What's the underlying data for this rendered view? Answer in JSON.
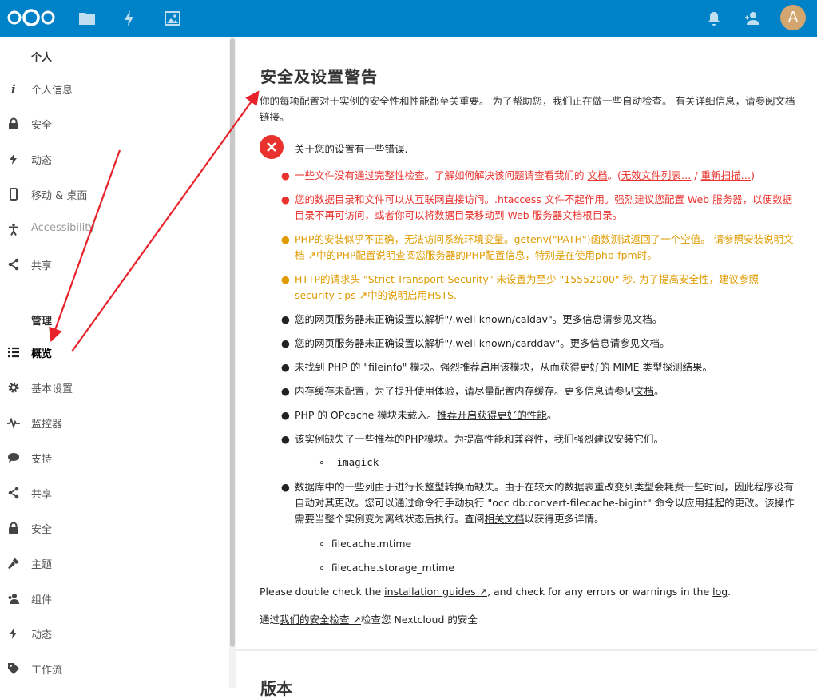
{
  "header": {
    "avatar_letter": "A",
    "icons": [
      "nextcloud-logo",
      "files-icon",
      "activity-icon",
      "gallery-icon",
      "notifications-icon",
      "contacts-icon"
    ],
    "bg_color": "#0082c9"
  },
  "sidebar": {
    "personal_title": "个人",
    "personal_items": [
      {
        "label": "个人信息",
        "icon": "info-icon"
      },
      {
        "label": "安全",
        "icon": "lock-icon"
      },
      {
        "label": "动态",
        "icon": "activity-icon"
      },
      {
        "label": "移动 & 桌面",
        "icon": "mobile-icon"
      },
      {
        "label": "Accessibility",
        "icon": "accessibility-icon"
      },
      {
        "label": "共享",
        "icon": "share-icon"
      }
    ],
    "admin_title": "管理",
    "admin_items": [
      {
        "label": "概览",
        "icon": "list-icon",
        "active": true
      },
      {
        "label": "基本设置",
        "icon": "gear-icon"
      },
      {
        "label": "监控器",
        "icon": "monitor-icon"
      },
      {
        "label": "支持",
        "icon": "chat-icon"
      },
      {
        "label": "共享",
        "icon": "share-icon"
      },
      {
        "label": "安全",
        "icon": "lock-icon"
      },
      {
        "label": "主题",
        "icon": "brush-icon"
      },
      {
        "label": "组件",
        "icon": "group-icon"
      },
      {
        "label": "动态",
        "icon": "activity-icon"
      },
      {
        "label": "工作流",
        "icon": "tag-icon"
      }
    ]
  },
  "main": {
    "title": "安全及设置警告",
    "intro": "你的每项配置对于实例的安全性和性能都至关重要。 为了帮助您，我们正在做一些自动检查。 有关详细信息，请参阅文档链接。",
    "error_heading": "关于您的设置有一些错误.",
    "warnings": {
      "w1_a": "一些文件没有通过完整性检查。了解如何解决该问题请查看我们的 ",
      "w1_link": "文档",
      "w1_b": "。(",
      "w1_link2": "无效文件列表…",
      "w1_c": " / ",
      "w1_link3": "重新扫描…",
      "w1_d": ")",
      "w2": "您的数据目录和文件可以从互联网直接访问。.htaccess 文件不起作用。强烈建议您配置 Web 服务器，以便数据目录不再可访问，或者你可以将数据目录移动到 Web 服务器文档根目录。",
      "w3_a": "PHP的安装似乎不正确，无法访问系统环境变量。getenv(\"PATH\")函数测试返回了一个空值。 请参照",
      "w3_link": "安装说明文档 ↗",
      "w3_b": "中的PHP配置说明查阅您服务器的PHP配置信息，特别是在使用php-fpm时。",
      "w4_a": "HTTP的请求头 \"Strict-Transport-Security\" 未设置为至少 \"15552000\" 秒. 为了提高安全性，建议参照",
      "w4_link": "security tips ↗",
      "w4_b": "中的说明启用HSTS.",
      "w5_a": "您的网页服务器未正确设置以解析\"/.well-known/caldav\"。更多信息请参见",
      "w5_link": "文档",
      "w5_b": "。",
      "w6_a": "您的网页服务器未正确设置以解析\"/.well-known/carddav\"。更多信息请参见",
      "w6_link": "文档",
      "w6_b": "。",
      "w7": "未找到 PHP 的 \"fileinfo\" 模块。强烈推荐启用该模块，从而获得更好的 MIME 类型探测结果。",
      "w8_a": "内存缓存未配置，为了提升使用体验，请尽量配置内存缓存。更多信息请参见",
      "w8_link": "文档",
      "w8_b": "。",
      "w9_a": "PHP 的 OPcache 模块未载入。",
      "w9_link": "推荐开启获得更好的性能",
      "w9_b": "。",
      "w10": "该实例缺失了一些推荐的PHP模块。为提高性能和兼容性，我们强烈建议安装它们。",
      "w10_sub": "imagick",
      "w11_a": "数据库中的一些列由于进行长整型转换而缺失。由于在较大的数据表重改变列类型会耗费一些时间，因此程序没有自动对其更改。您可以通过命令行手动执行 \"occ db:convert-filecache-bigint\" 命令以应用挂起的更改。该操作需要当整个实例变为离线状态后执行。查阅",
      "w11_link": "相关文档",
      "w11_b": "以获得更多详情。",
      "w11_sub1": "filecache.mtime",
      "w11_sub2": "filecache.storage_mtime"
    },
    "check_a": "Please double check the ",
    "check_link": "installation guides ↗",
    "check_b": ", and check for any errors or warnings in the ",
    "check_link2": "log",
    "check_c": ".",
    "scan_a": "通过",
    "scan_link": "我们的安全检查 ↗",
    "scan_b": "检查您 Nextcloud 的安全",
    "version_title": "版本"
  },
  "colors": {
    "error": "#e9322d",
    "warning": "#e09b00",
    "annotation_arrow": "#e8222a"
  }
}
